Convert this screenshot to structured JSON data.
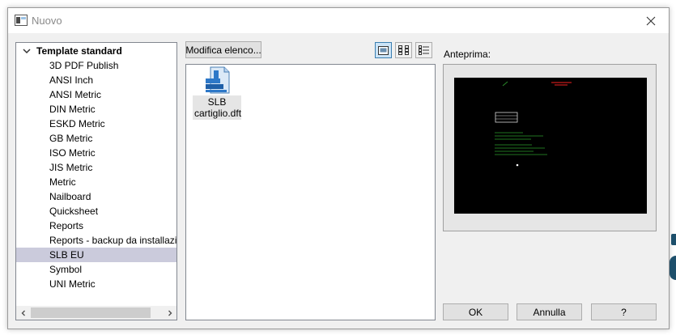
{
  "window": {
    "title": "Nuovo"
  },
  "tree": {
    "root_label": "Template standard",
    "items": [
      "3D PDF Publish",
      "ANSI Inch",
      "ANSI Metric",
      "DIN Metric",
      "ESKD Metric",
      "GB Metric",
      "ISO Metric",
      "JIS Metric",
      "Metric",
      "Nailboard",
      "Quicksheet",
      "Reports",
      "Reports - backup da installazio",
      "SLB EU",
      "Symbol",
      "UNI Metric"
    ],
    "selected": "SLB EU"
  },
  "toolbar": {
    "modify_list_label": "Modifica elenco...",
    "view_buttons": [
      "large-icons-view-icon",
      "small-icons-view-icon",
      "list-view-icon"
    ],
    "active_view": "large-icons-view-icon"
  },
  "files": [
    {
      "label_line1": "SLB",
      "label_line2": "cartiglio.dft",
      "icon": "draft-document-icon"
    }
  ],
  "preview": {
    "label": "Anteprima:"
  },
  "buttons": {
    "ok": "OK",
    "cancel": "Annulla",
    "help": "?"
  },
  "colors": {
    "selection": "#cbcbdc",
    "preview_bg": "#000000",
    "active_view": "#cce4f7"
  }
}
